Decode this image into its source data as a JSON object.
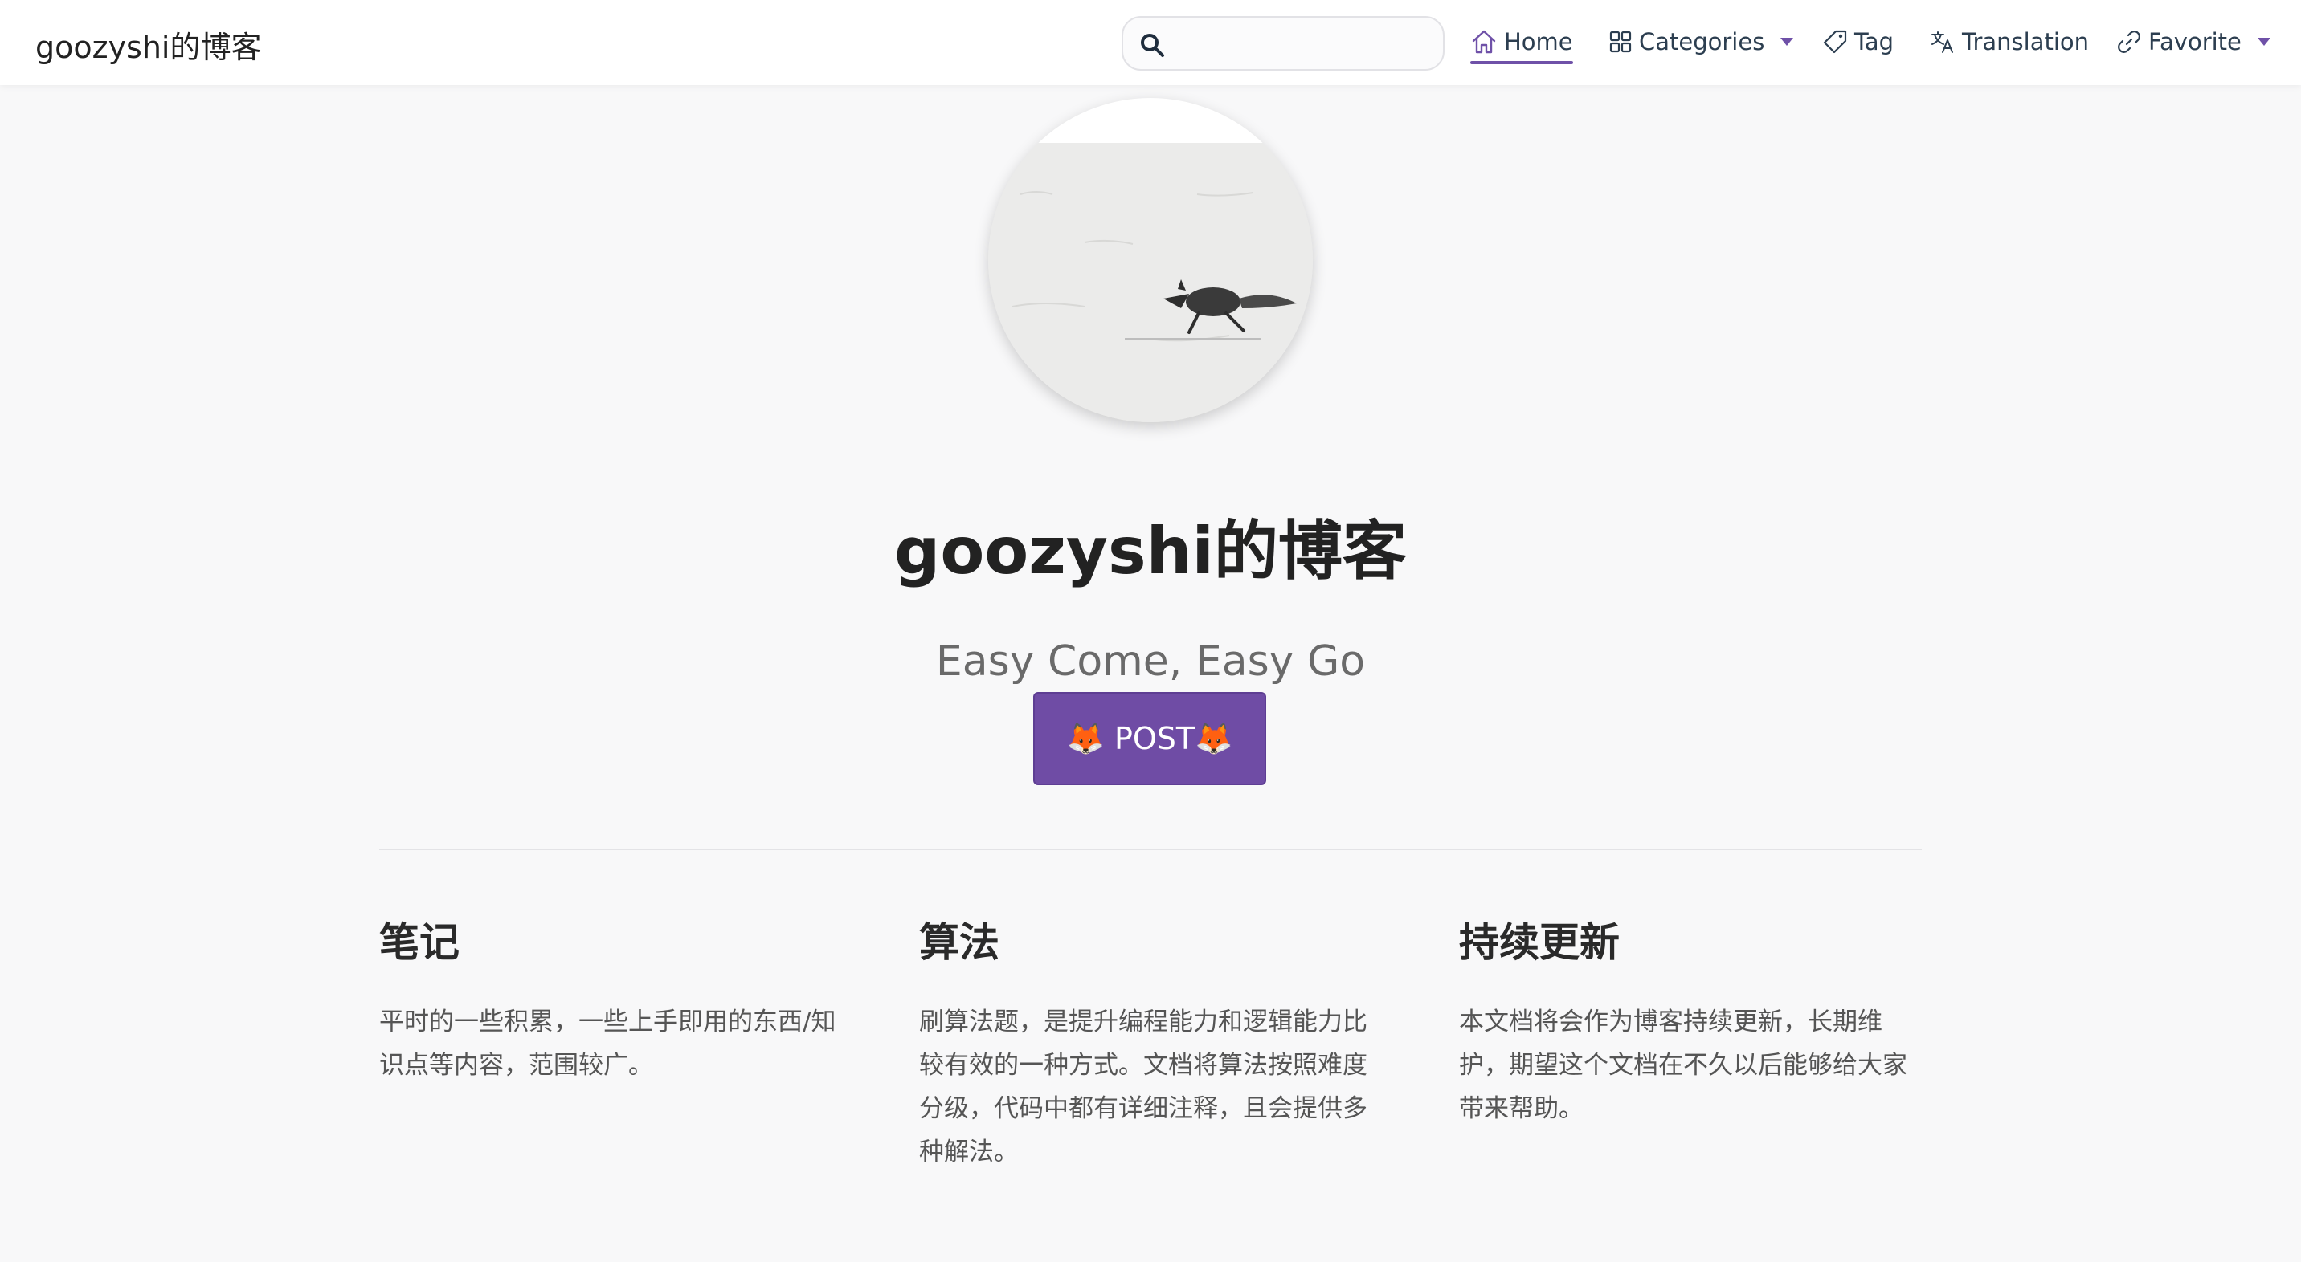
{
  "navbar": {
    "site_name": "goozyshi的博客",
    "search": {
      "value": "",
      "placeholder": ""
    },
    "items": [
      {
        "label": "Home",
        "icon": "home-icon",
        "active": true
      },
      {
        "label": "Categories",
        "icon": "grid-icon",
        "dropdown": true
      },
      {
        "label": "Tag",
        "icon": "tag-icon"
      },
      {
        "label": "Translation",
        "icon": "translate-icon"
      },
      {
        "label": "Favorite",
        "icon": "link-icon",
        "dropdown": true
      }
    ]
  },
  "hero": {
    "image": "running-fox-in-snow",
    "title": "goozyshi的博客",
    "description": "Easy Come, Easy Go",
    "button_label": "🦊 POST🦊"
  },
  "features": [
    {
      "title": "笔记",
      "details": "平时的一些积累，一些上手即用的东西/知识点等内容，范围较广。"
    },
    {
      "title": "算法",
      "details": "刷算法题，是提升编程能力和逻辑能力比较有效的一种方式。文档将算法按照难度分级，代码中都有详细注释，且会提供多种解法。"
    },
    {
      "title": "持续更新",
      "details": "本文档将会作为博客持续更新，长期维护，期望这个文档在不久以后能够给大家带来帮助。"
    }
  ],
  "colors": {
    "accent": "#6f4ca5",
    "background": "#f8f8f9",
    "navbar_bg": "#ffffff",
    "text": "#2c3e50"
  }
}
